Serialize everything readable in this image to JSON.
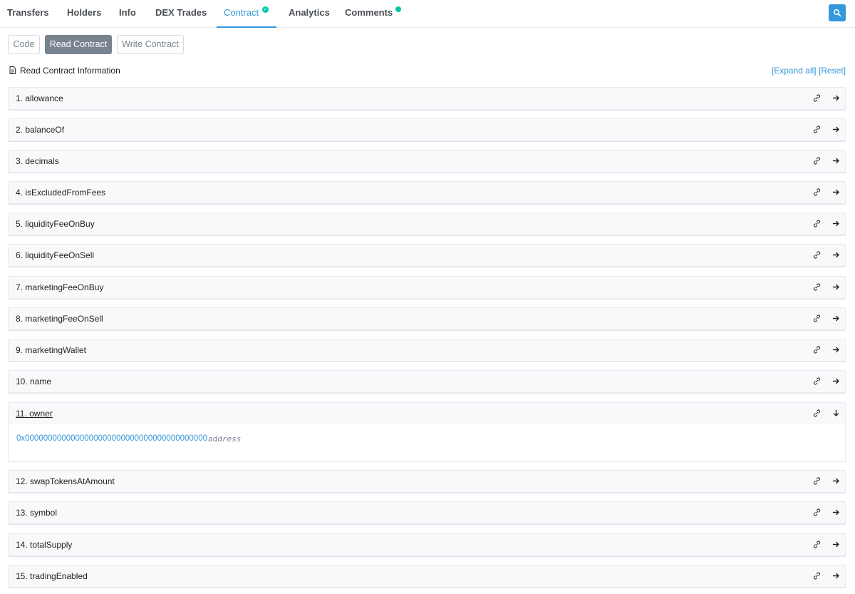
{
  "tabs": [
    {
      "label": "Transfers"
    },
    {
      "label": "Holders"
    },
    {
      "label": "Info"
    },
    {
      "label": "DEX Trades"
    },
    {
      "label": "Contract",
      "active": true,
      "badge": "verified-check-icon"
    },
    {
      "label": "Analytics"
    },
    {
      "label": "Comments",
      "badge": "notification-dot-icon"
    }
  ],
  "search": {
    "icon": "search-icon",
    "color": "#3498db"
  },
  "subtabs": {
    "code": "Code",
    "read": "Read Contract",
    "write": "Write Contract"
  },
  "info": {
    "title": "Read Contract Information",
    "expand_all": "[Expand all]",
    "reset": "[Reset]"
  },
  "functions": [
    {
      "label": "1. allowance"
    },
    {
      "label": "2. balanceOf"
    },
    {
      "label": "3. decimals"
    },
    {
      "label": "4. isExcludedFromFees"
    },
    {
      "label": "5. liquidityFeeOnBuy"
    },
    {
      "label": "6. liquidityFeeOnSell"
    },
    {
      "label": "7. marketingFeeOnBuy"
    },
    {
      "label": "8. marketingFeeOnSell"
    },
    {
      "label": "9. marketingWallet"
    },
    {
      "label": "10. name"
    },
    {
      "label": "11. owner",
      "expanded": true
    },
    {
      "label": "12. swapTokensAtAmount"
    },
    {
      "label": "13. symbol"
    },
    {
      "label": "14. totalSupply"
    },
    {
      "label": "15. tradingEnabled"
    }
  ],
  "owner_result": {
    "value": "0x0000000000000000000000000000000000000000",
    "type": "address"
  },
  "colors": {
    "accent": "#3498db",
    "badge": "#00c9a7",
    "active_subtab": "#77838f"
  }
}
